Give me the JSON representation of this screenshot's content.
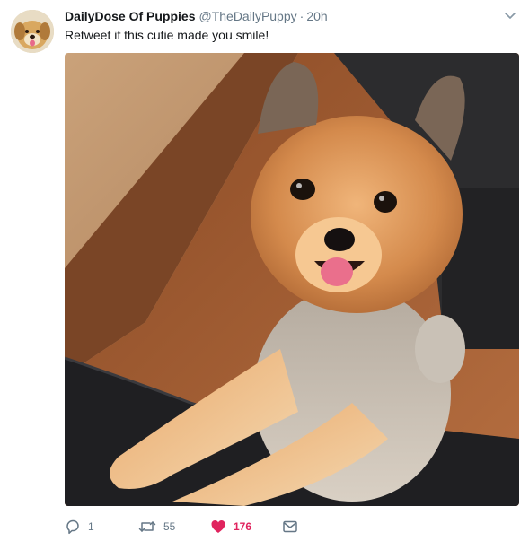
{
  "tweet": {
    "author_name": "DailyDose Of Puppies",
    "handle": "@TheDailyPuppy",
    "separator": "·",
    "time": "20h",
    "text": "Retweet if this cutie made you smile!",
    "avatar_icon": "puppy-avatar",
    "media_icon": "pomeranian-photo"
  },
  "actions": {
    "reply_count": "1",
    "retweet_count": "55",
    "like_count": "176",
    "reply_icon": "reply-icon",
    "retweet_icon": "retweet-icon",
    "like_icon": "heart-icon",
    "message_icon": "envelope-icon"
  },
  "colors": {
    "like": "#e0245e",
    "secondary_text": "#657786",
    "primary_text": "#14171a"
  }
}
